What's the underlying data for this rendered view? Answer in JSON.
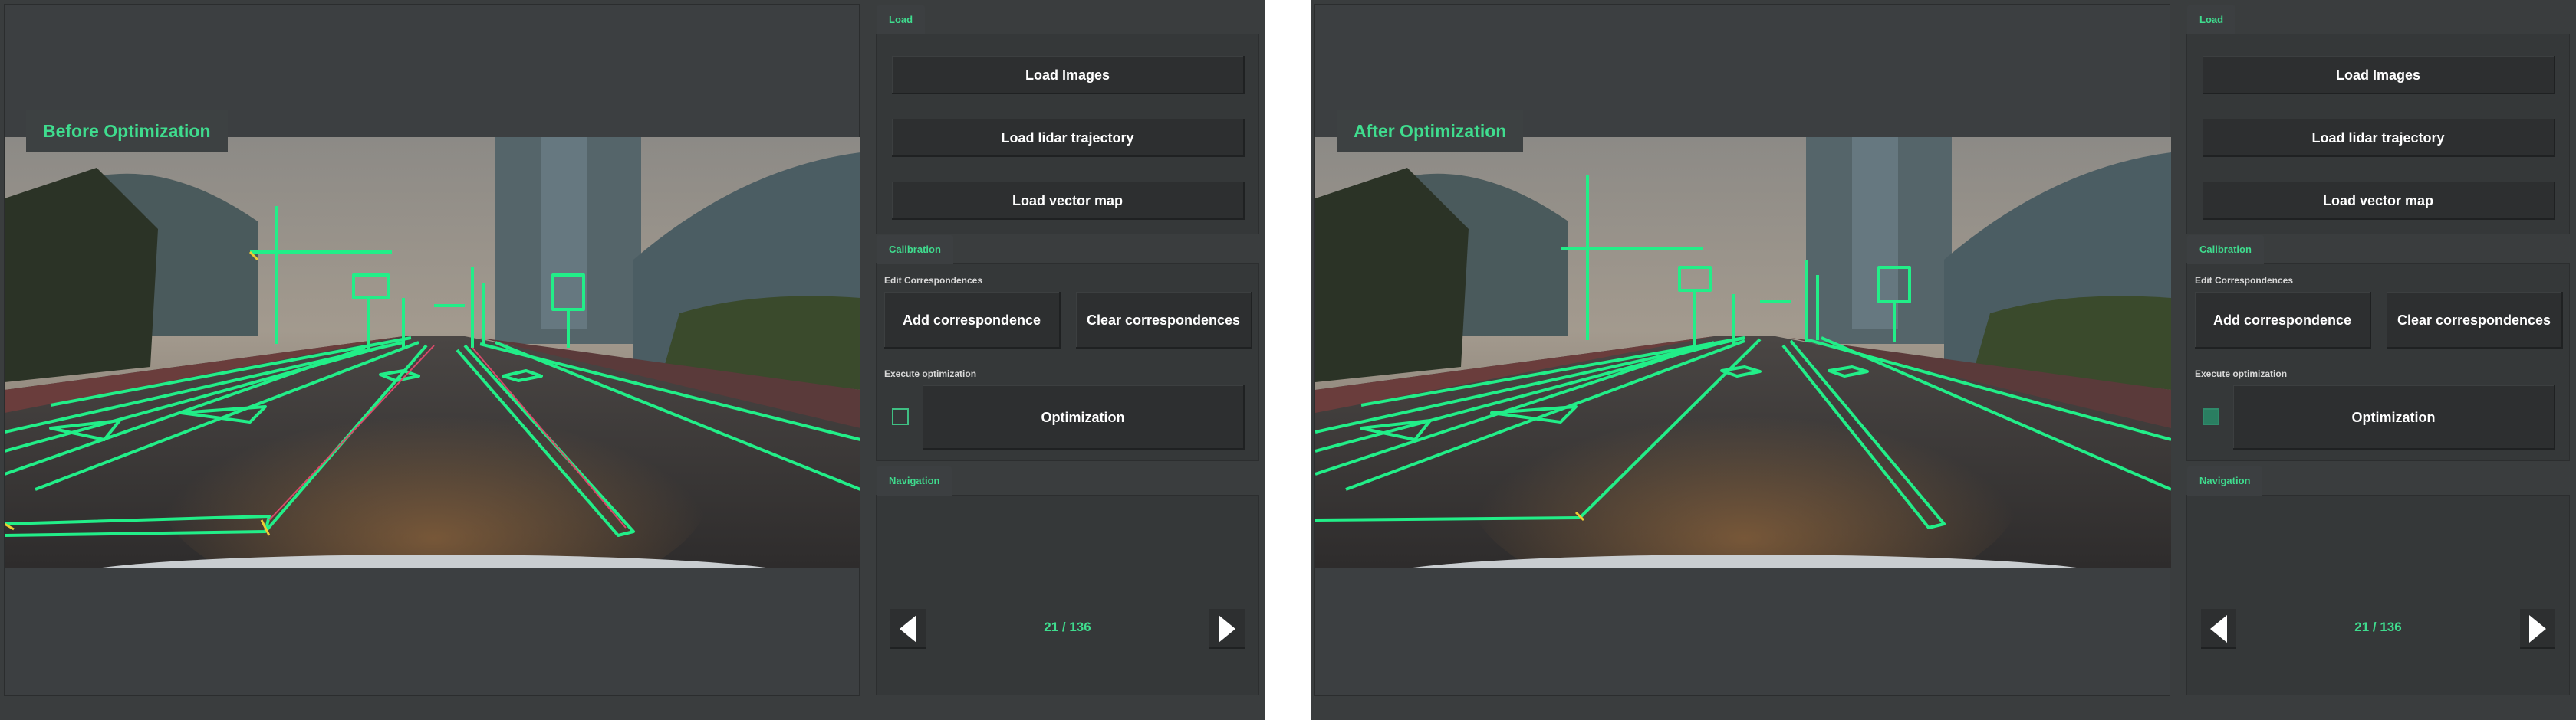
{
  "colors": {
    "accent": "#3fdc8e",
    "window_bg": "#3a3d3e",
    "panel_bg": "#353839",
    "button_bg": "#2d2f30",
    "overlay_line": "#22ee88"
  },
  "windows": [
    {
      "viewport_title": "Before Optimization",
      "load_tab": "Load",
      "load_images": "Load Images",
      "load_lidar": "Load lidar trajectory",
      "load_vector_map": "Load vector map",
      "calibration_tab": "Calibration",
      "edit_correspondences": "Edit Correspondences",
      "add_correspondence": "Add correspondence",
      "clear_correspondences": "Clear correspondences",
      "execute_optimization": "Execute optimization",
      "optimization": "Optimization",
      "optimization_checked": false,
      "navigation_tab": "Navigation",
      "page_indicator": "21 / 136",
      "prev_icon": "triangle-left-icon",
      "next_icon": "triangle-right-icon"
    },
    {
      "viewport_title": "After Optimization",
      "load_tab": "Load",
      "load_images": "Load Images",
      "load_lidar": "Load lidar trajectory",
      "load_vector_map": "Load vector map",
      "calibration_tab": "Calibration",
      "edit_correspondences": "Edit Correspondences",
      "add_correspondence": "Add correspondence",
      "clear_correspondences": "Clear correspondences",
      "execute_optimization": "Execute optimization",
      "optimization": "Optimization",
      "optimization_checked": true,
      "navigation_tab": "Navigation",
      "page_indicator": "21 / 136",
      "prev_icon": "triangle-left-icon",
      "next_icon": "triangle-right-icon"
    }
  ]
}
